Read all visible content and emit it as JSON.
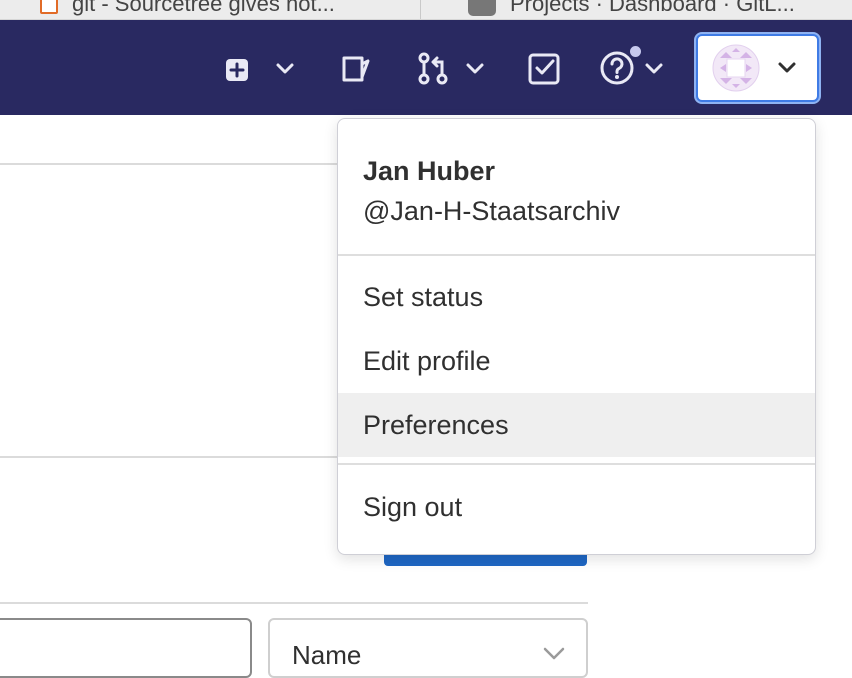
{
  "browser": {
    "tabs": [
      {
        "label": "git - Sourcetree gives not..."
      },
      {
        "label": "Projects · Dashboard · GitL..."
      }
    ]
  },
  "navbar": {
    "background": "#292961",
    "icons": [
      "plus-square-icon",
      "chevron-down-icon",
      "snippet-icon",
      "merge-request-icon",
      "chevron-down-icon",
      "todo-icon",
      "help-icon",
      "chevron-down-icon",
      "avatar",
      "chevron-down-icon"
    ]
  },
  "user_menu": {
    "name": "Jan Huber",
    "username": "@Jan-H-Staatsarchiv",
    "items": [
      {
        "label": "Set status"
      },
      {
        "label": "Edit profile"
      },
      {
        "label": "Preferences",
        "hovered": true
      },
      {
        "label": "Sign out"
      }
    ]
  },
  "page": {
    "sort_select": {
      "value": "Name"
    }
  },
  "colors": {
    "accent": "#1f67c4",
    "focus_ring": "#3f7be5"
  }
}
